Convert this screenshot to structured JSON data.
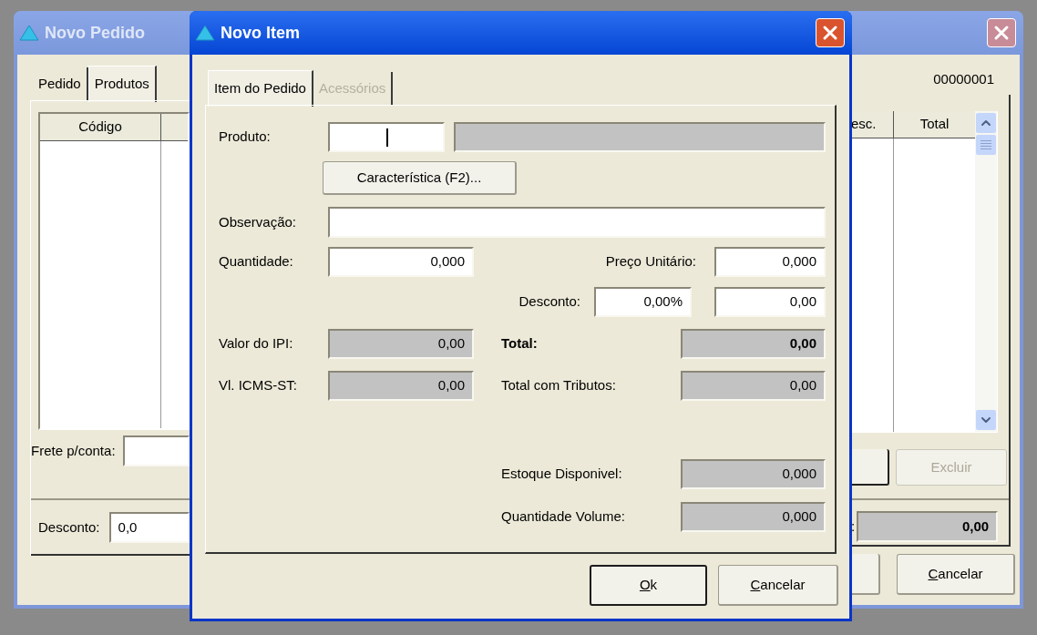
{
  "order_window": {
    "title": "Novo Pedido",
    "active": false,
    "tabs": [
      {
        "label": "Pedido",
        "selected": false
      },
      {
        "label": "Produtos",
        "selected": true
      }
    ],
    "order_number": "00000001",
    "table": {
      "columns": [
        "Código",
        "esc.",
        "Total"
      ]
    },
    "freight": {
      "label": "Frete p/conta:"
    },
    "delete_button": {
      "label": "Excluir",
      "disabled": true
    },
    "discount": {
      "label": "Desconto:",
      "value": "0,0"
    },
    "total": {
      "label": ":",
      "value": "0,00",
      "readonly": true
    },
    "buttons": [
      {
        "label": "Cancelar",
        "mnemonic": true
      }
    ]
  },
  "item_window": {
    "title": "Novo Item",
    "active": true,
    "tabs": [
      {
        "label": "Item do Pedido",
        "selected": true,
        "disabled": false
      },
      {
        "label": "Acessórios",
        "selected": false,
        "disabled": true
      }
    ],
    "product": {
      "label": "Produto:",
      "focused": true
    },
    "feature_button": "Característica (F2)...",
    "note": {
      "label": "Observação:"
    },
    "quantity": {
      "label": "Quantidade:",
      "value": "0,000",
      "readonly": false
    },
    "unit_price": {
      "label": "Preço Unitário:",
      "value": "0,000",
      "readonly": false
    },
    "discount": {
      "label": "Desconto:",
      "percent": "0,00%",
      "value": "0,00",
      "readonly": false
    },
    "ipi": {
      "label": "Valor do IPI:",
      "value": "0,00",
      "readonly": true
    },
    "total": {
      "label": "Total:",
      "value": "0,00",
      "readonly": true
    },
    "icms_st": {
      "label": "Vl. ICMS-ST:",
      "value": "0,00",
      "readonly": true
    },
    "total_with_taxes": {
      "label": "Total com Tributos:",
      "value": "0,00",
      "readonly": true
    },
    "stock": {
      "label": "Estoque Disponivel:",
      "value": "0,000",
      "readonly": true
    },
    "volume": {
      "label": "Quantidade Volume:",
      "value": "0,000",
      "readonly": true
    },
    "buttons": [
      {
        "label": "Ok",
        "default": true,
        "mnemonic": true
      },
      {
        "label": "Cancelar",
        "default": false,
        "mnemonic": true
      }
    ]
  }
}
